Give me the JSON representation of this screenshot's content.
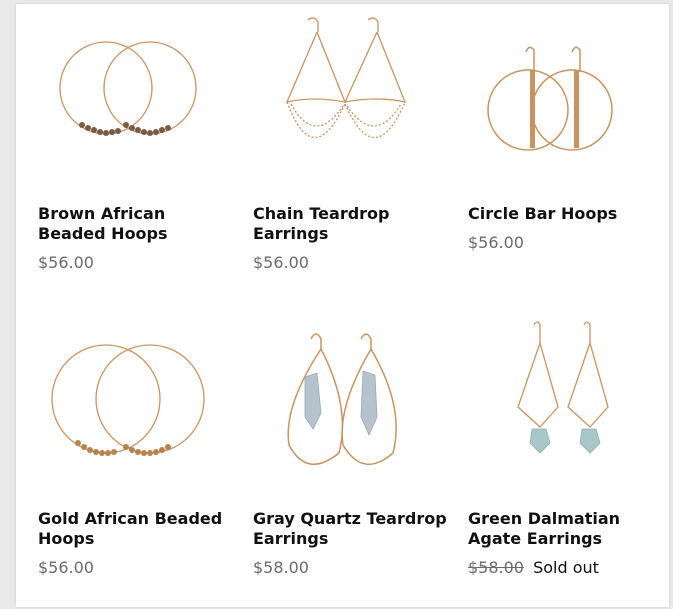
{
  "products": [
    {
      "title": "Brown African Beaded Hoops",
      "price": "$56.00",
      "icon": "brown-beaded-hoops-icon"
    },
    {
      "title": "Chain Teardrop Earrings",
      "price": "$56.00",
      "icon": "chain-teardrop-earrings-icon"
    },
    {
      "title": "Circle Bar Hoops",
      "price": "$56.00",
      "icon": "circle-bar-hoops-icon"
    },
    {
      "title": "Gold African Beaded Hoops",
      "price": "$56.00",
      "icon": "gold-beaded-hoops-icon"
    },
    {
      "title": "Gray Quartz Teardrop Earrings",
      "price": "$58.00",
      "icon": "gray-quartz-teardrop-icon"
    },
    {
      "title": "Green Dalmatian Agate Earrings",
      "price": "$58.00",
      "status": "Sold out",
      "icon": "green-agate-earrings-icon"
    }
  ],
  "colors": {
    "gold": "#c9935f",
    "title": "#111111",
    "price": "#6b6b6b",
    "bead_brown": "#7a5a44",
    "bead_gold": "#b7834f",
    "stone_gray": "#b6c3cf",
    "stone_green": "#a9c6c8"
  }
}
